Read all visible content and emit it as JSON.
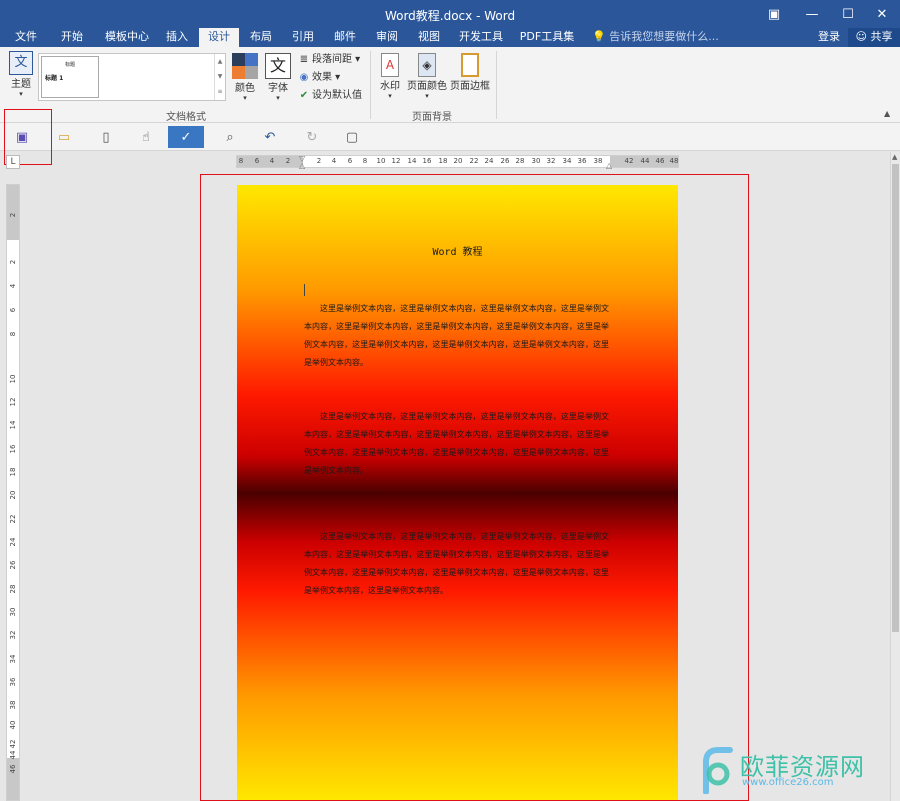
{
  "window": {
    "title": "Word教程.docx - Word",
    "restore_icon": "ribbon-display-icon",
    "minimize": "—",
    "maximize": "☐",
    "close": "✕"
  },
  "tabs": [
    {
      "label": "文件"
    },
    {
      "label": "开始"
    },
    {
      "label": "模板中心"
    },
    {
      "label": "插入"
    },
    {
      "label": "设计"
    },
    {
      "label": "布局"
    },
    {
      "label": "引用"
    },
    {
      "label": "邮件"
    },
    {
      "label": "审阅"
    },
    {
      "label": "视图"
    },
    {
      "label": "开发工具"
    },
    {
      "label": "PDF工具集"
    }
  ],
  "tellme": "告诉我您想要做什么...",
  "login": "登录",
  "share": "共享",
  "ribbon": {
    "theme_label": "主题",
    "theme_icon_text": "文",
    "gallery_thumb_title": "标题",
    "gallery_thumb_heading": "标题 1",
    "colors_label": "颜色",
    "fonts_label": "字体",
    "fonts_icon_text": "文",
    "paragraph_spacing": "段落间距",
    "effects": "效果",
    "set_default": "设为默认值",
    "group_doc_format": "文档格式",
    "watermark_label": "水印",
    "page_color_label": "页面颜色",
    "page_border_label": "页面边框",
    "group_page_bg": "页面背景"
  },
  "ruler": {
    "h_left": [
      "8",
      "6",
      "4",
      "2"
    ],
    "h_right": [
      "2",
      "4",
      "6",
      "8",
      "10",
      "12",
      "14",
      "16",
      "18",
      "20",
      "22",
      "24",
      "26",
      "28",
      "30",
      "32",
      "34",
      "36",
      "38"
    ],
    "h_margin_right": [
      "42",
      "44",
      "46",
      "48"
    ],
    "v_top": "2",
    "v": [
      "2",
      "4",
      "6",
      "8",
      "10",
      "12",
      "14",
      "16",
      "18",
      "20",
      "22",
      "24",
      "26",
      "28",
      "30",
      "32",
      "34",
      "36",
      "38",
      "40",
      "42",
      "44"
    ],
    "v_bottom": "46"
  },
  "document": {
    "title": "Word 教程",
    "paragraphs": [
      "这里是举例文本内容，这里是举例文本内容，这里是举例文本内容，这里是举例文本内容，这里是举例文本内容，这里是举例文本内容，这里是举例文本内容，这里是举例文本内容，这里是举例文本内容，这里是举例文本内容，这里是举例文本内容，这里是举例文本内容。",
      "这里是举例文本内容，这里是举例文本内容，这里是举例文本内容，这里是举例文本内容，这里是举例文本内容，这里是举例文本内容，这里是举例文本内容，这里是举例文本内容，这里是举例文本内容，这里是举例文本内容，这里是举例文本内容，这里是举例文本内容。",
      "这里是举例文本内容，这里是举例文本内容，这里是举例文本内容，这里是举例文本内容，这里是举例文本内容，这里是举例文本内容，这里是举例文本内容，这里是举例文本内容，这里是举例文本内容，这里是举例文本内容，这里是举例文本内容，这里是举例文本内容，这里是举例文本内容。"
    ]
  },
  "watermark": {
    "text": "欧菲资源网",
    "url": "www.office26.com"
  },
  "colors": {
    "title_bar": "#2b579a",
    "highlight": "#e0101a"
  }
}
